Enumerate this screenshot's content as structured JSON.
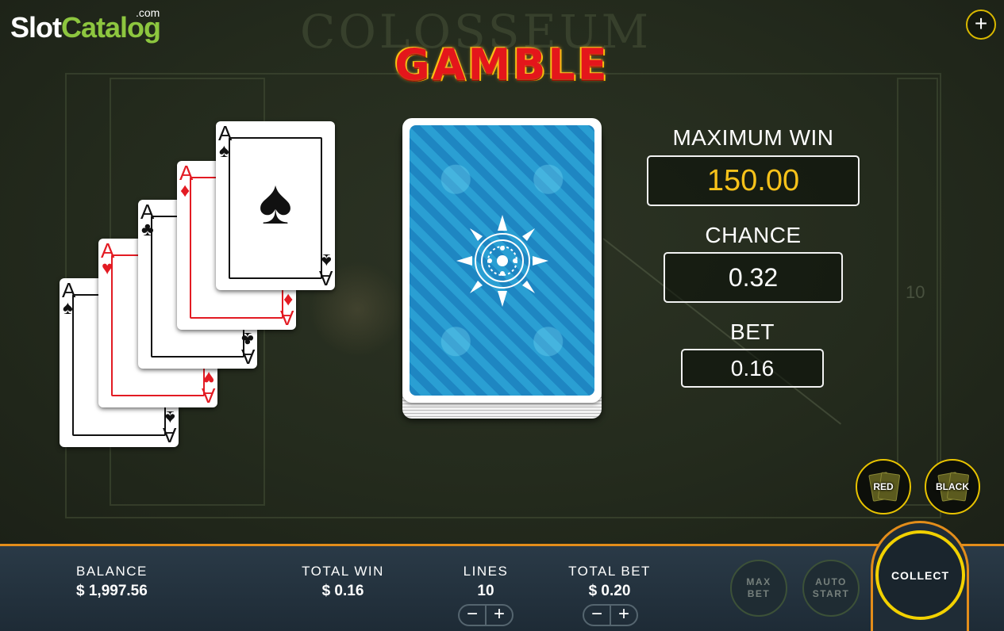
{
  "logo": {
    "part1": "Slot",
    "part2": "Catalog",
    "suffix": ".com"
  },
  "background": {
    "title_text": "COLOSSEUM",
    "reel_number": "10"
  },
  "top_right": {
    "plus_label": "+"
  },
  "title": "GAMBLE",
  "history_cards": [
    {
      "rank": "A",
      "suit": "♠",
      "color": "black"
    },
    {
      "rank": "A",
      "suit": "♥",
      "color": "red"
    },
    {
      "rank": "A",
      "suit": "♣",
      "color": "black"
    },
    {
      "rank": "A",
      "suit": "♦",
      "color": "red"
    },
    {
      "rank": "A",
      "suit": "♠",
      "color": "black"
    }
  ],
  "info": {
    "max_win_label": "MAXIMUM WIN",
    "max_win_value": "150.00",
    "chance_label": "CHANCE",
    "chance_value": "0.32",
    "bet_label": "BET",
    "bet_value": "0.16"
  },
  "choices": {
    "red_label": "RED",
    "black_label": "BLACK"
  },
  "bottom_bar": {
    "balance_label": "BALANCE",
    "balance_value": "$ 1,997.56",
    "total_win_label": "TOTAL WIN",
    "total_win_value": "$ 0.16",
    "lines_label": "LINES",
    "lines_value": "10",
    "total_bet_label": "TOTAL BET",
    "total_bet_value": "$ 0.20",
    "minus": "−",
    "plus": "+",
    "max_bet_label": "MAX BET",
    "auto_start_label": "AUTO START",
    "collect_label": "COLLECT"
  },
  "colors": {
    "accent_gold": "#f7c21a",
    "title_red": "#e4161b",
    "bar_border": "#e38d1a",
    "collect_ring": "#f2d100",
    "logo_green": "#8dc63f"
  }
}
